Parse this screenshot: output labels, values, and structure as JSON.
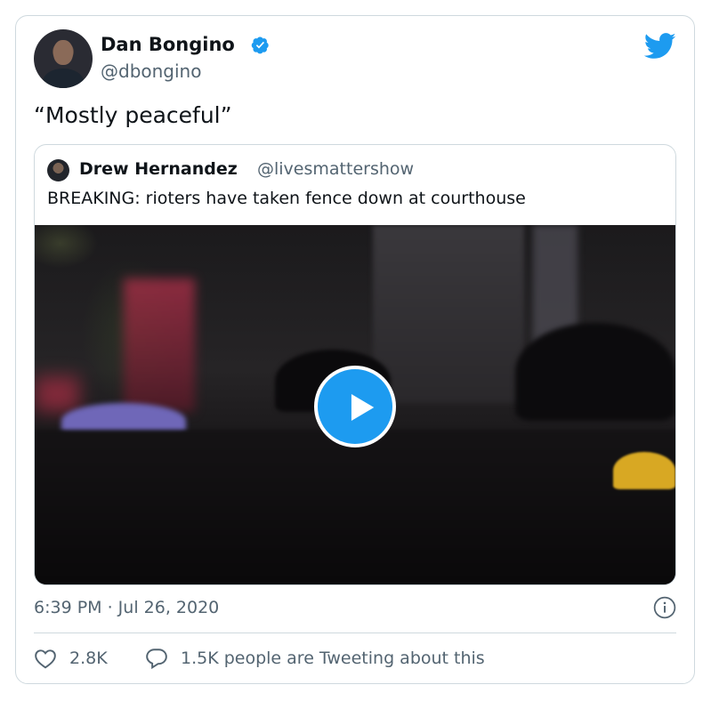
{
  "author": {
    "name": "Dan Bongino",
    "handle": "@dbongino",
    "verified": true
  },
  "tweet": {
    "text": "“Mostly peaceful”",
    "timestamp": "6:39 PM · Jul 26, 2020"
  },
  "quoted_tweet": {
    "name": "Drew Hernandez",
    "handle": "@livesmattershow",
    "text": "BREAKING: rioters have taken fence down at courthouse"
  },
  "engagement": {
    "likes": "2.8K",
    "conversation": "1.5K people are Tweeting about this"
  },
  "icons": [
    "verified-badge-icon",
    "twitter-bird-icon",
    "play-icon",
    "info-icon",
    "heart-icon",
    "reply-bubble-icon"
  ],
  "colors": {
    "accent": "#1d9bf0",
    "secondary_text": "#536471",
    "border": "#cfd9de"
  }
}
